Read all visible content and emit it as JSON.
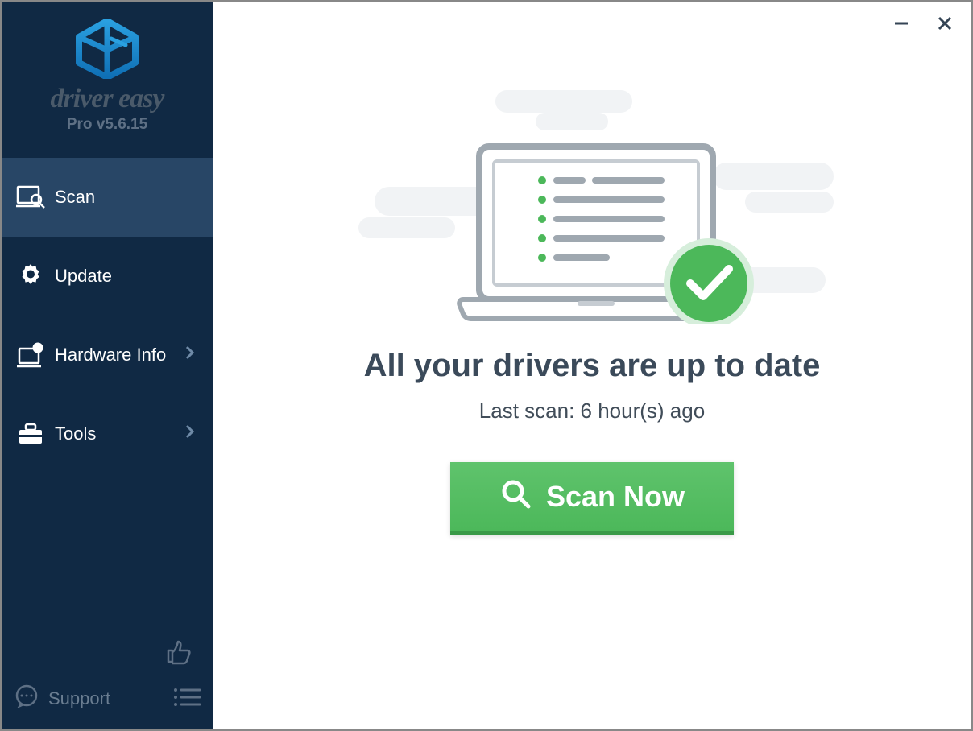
{
  "brand": {
    "name": "driver easy",
    "version": "Pro v5.6.15"
  },
  "sidebar": {
    "items": [
      {
        "label": "Scan",
        "icon": "scan-icon",
        "active": true,
        "expandable": false
      },
      {
        "label": "Update",
        "icon": "gear-icon",
        "active": false,
        "expandable": false
      },
      {
        "label": "Hardware Info",
        "icon": "hardware-icon",
        "active": false,
        "expandable": true
      },
      {
        "label": "Tools",
        "icon": "toolbox-icon",
        "active": false,
        "expandable": true
      }
    ],
    "support_label": "Support"
  },
  "main": {
    "headline": "All your drivers are up to date",
    "last_scan": "Last scan: 6 hour(s) ago",
    "scan_button": "Scan Now"
  },
  "colors": {
    "sidebar_bg": "#102944",
    "sidebar_active": "#284666",
    "accent_green": "#4cb85a",
    "headline": "#3b4a5a"
  }
}
